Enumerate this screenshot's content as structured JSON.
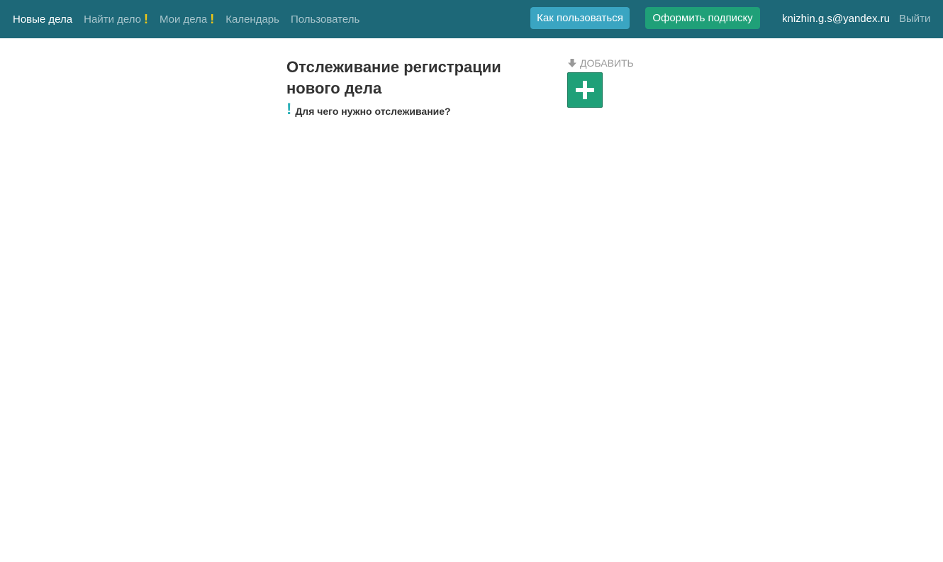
{
  "nav": {
    "items": [
      {
        "label": "Новые дела",
        "active": true,
        "warning": false
      },
      {
        "label": "Найти дело",
        "active": false,
        "warning": true
      },
      {
        "label": "Мои дела",
        "active": false,
        "warning": true
      },
      {
        "label": "Календарь",
        "active": false,
        "warning": false
      },
      {
        "label": "Пользователь",
        "active": false,
        "warning": false
      }
    ],
    "warning_mark": "!",
    "how_to_use": "Как пользоваться",
    "subscribe": "Оформить подписку",
    "user_email": "knizhin.g.s@yandex.ru",
    "logout": "Выйти"
  },
  "main": {
    "title": "Отслеживание регистрации нового дела",
    "info_mark": "!",
    "info_link": "Для чего нужно отслеживание?",
    "add_label": "ДОБАВИТЬ",
    "add_icon": "plus-icon",
    "arrow_icon": "arrow-down-icon"
  },
  "colors": {
    "navbar": "#1d6878",
    "warning": "#f0c814",
    "how_button": "#3aa5c2",
    "subscribe_button": "#1fa078",
    "add_button": "#1fa078",
    "info_mark": "#2cb0b8"
  }
}
